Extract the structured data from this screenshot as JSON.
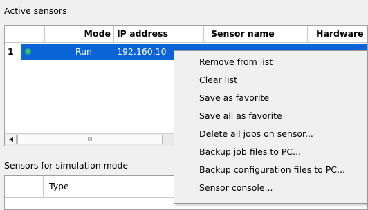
{
  "active_sensors": {
    "title": "Active sensors",
    "columns": [
      "Mode",
      "IP address",
      "Sensor name",
      "Hardware"
    ],
    "rows": [
      {
        "num": "1",
        "status": "online",
        "mode": "Run",
        "ip": "192.160.10"
      }
    ],
    "scroll_left_glyph": "◀",
    "scroll_thumb_grip": "III"
  },
  "simulation": {
    "title": "Sensors for simulation mode",
    "columns": [
      "Type",
      "I"
    ]
  },
  "context_menu": {
    "items": [
      "Remove from list",
      "Clear list",
      "Save as favorite",
      "Save all as favorite",
      "Delete all jobs on sensor...",
      "Backup job files to PC...",
      "Backup configuration files to PC...",
      "Sensor console..."
    ]
  },
  "colors": {
    "selection": "#0a64d6",
    "status_led": "#2ecc40",
    "menu_bg": "#f0f0f0"
  }
}
